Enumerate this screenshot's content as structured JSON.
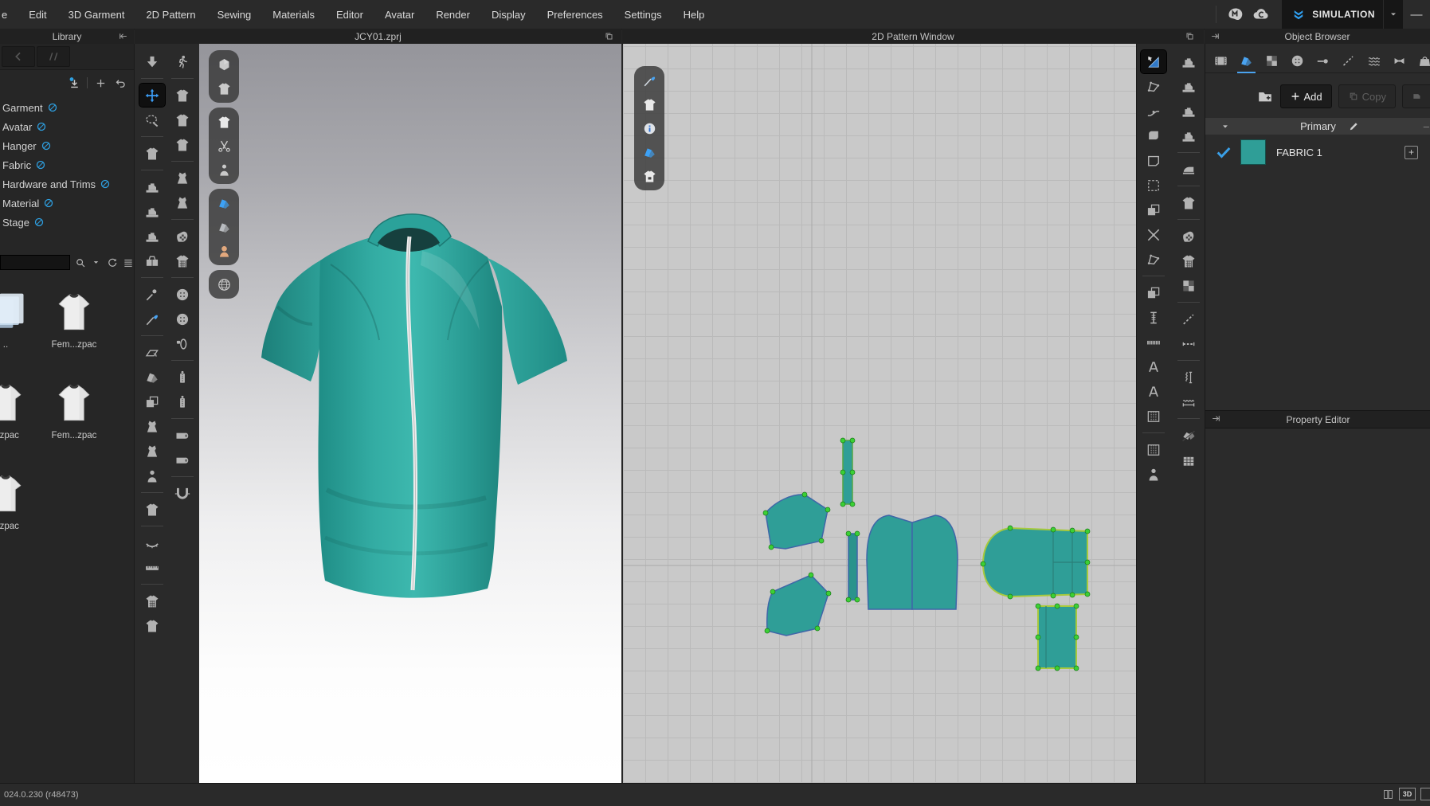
{
  "menu": {
    "items": [
      "e",
      "Edit",
      "3D Garment",
      "2D Pattern",
      "Sewing",
      "Materials",
      "Editor",
      "Avatar",
      "Render",
      "Display",
      "Preferences",
      "Settings",
      "Help"
    ]
  },
  "topbar": {
    "simulation": "SIMULATION"
  },
  "panels": {
    "library": "Library",
    "viewport3d": "JCY01.zprj",
    "pattern2d": "2D Pattern Window",
    "object_browser": "Object Browser",
    "property_editor": "Property Editor"
  },
  "library": {
    "categories": [
      "Garment",
      "Avatar",
      "Hanger",
      "Fabric",
      "Hardware and Trims",
      "Material",
      "Stage"
    ],
    "search_value": "",
    "thumbnails": [
      {
        "label": "..",
        "type": "folder"
      },
      {
        "label": "Fem...zpac",
        "type": "garment"
      },
      {
        "label": "...zpac",
        "type": "garment"
      },
      {
        "label": "Fem...zpac",
        "type": "garment"
      },
      {
        "label": "...zpac",
        "type": "garment"
      }
    ]
  },
  "toolbars": {
    "col_a": [
      "download-arrange",
      "sep",
      "move",
      "lasso-brush",
      "sep",
      "fit-garment",
      "sep",
      "sew-machine",
      "sew-machine-edit",
      "sew-machine-free",
      "sew-pieces",
      "sep",
      "pin-tack",
      "pen-3d",
      "sep",
      "fold-arrange",
      "folded-garment",
      "garment-pair",
      "wrap-drape",
      "wrap-rotate",
      "avatar-garment",
      "sep",
      "pattern-scale",
      "sep",
      "tape-curve",
      "tape-measure",
      "sep",
      "garment-measure",
      "garment-measure-b"
    ],
    "col_b": [
      "walk-avatar",
      "sep",
      "pin-garment",
      "pin-garment-b",
      "pin-garment-c",
      "sep",
      "pin-dress",
      "pin-dress-b",
      "sep",
      "glove-checker",
      "mesh-garment",
      "sep",
      "button-place",
      "button",
      "buttonhole",
      "sep",
      "zipper",
      "zipper-b",
      "sep",
      "fabric-roll",
      "fabric-roll-b",
      "sep",
      "magnet-pin"
    ],
    "float_3d": [
      [
        "view-cube",
        "garment-style"
      ],
      [
        "garment-show",
        "scissors-garment",
        "avatar-show"
      ],
      [
        "fabric-show",
        "fabric-texture",
        "avatar-skin"
      ],
      [
        "environment-globe"
      ]
    ],
    "float_2d": [
      [
        "needle-edit",
        "garment-2d",
        "pattern-info",
        "fabric-2d",
        "garment-lock"
      ]
    ],
    "col_c": [
      "transform-pattern",
      "edit-pattern",
      "edit-curvature",
      "pattern-shape",
      "pattern-outline",
      "marquee-select",
      "pattern-pair",
      "cross-tool",
      "trace-pattern",
      "sep",
      "clone-pattern",
      "notch-tool",
      "seam-tape",
      "text-pin",
      "text-tool",
      "pleats-tool",
      "sep",
      "strip-stack",
      "layer-mannequin"
    ],
    "col_d": [
      "sew-free",
      "sew-flat",
      "sew-curve",
      "sew-detect",
      "sep",
      "iron-press",
      "sep",
      "garment-fit-2d",
      "sep",
      "glove-2d",
      "mesh-2d",
      "checker-2d",
      "sep",
      "baste-pin",
      "baste",
      "sep",
      "shirring-pin",
      "shirring-tool",
      "sep",
      "pattern-cut",
      "gift-wrap"
    ]
  },
  "object_browser": {
    "tabs": [
      "scene-tab",
      "fabric-tab",
      "material-tab",
      "button-tab",
      "tack-tab",
      "topstitch-tab",
      "shirring-tab",
      "trim-tab",
      "accessory-tab"
    ],
    "active_tab": "fabric-tab",
    "add_label": "Add",
    "copy_label": "Copy",
    "section_label": "Primary",
    "fabric_name": "FABRIC 1",
    "fabric_color": "#2f9e97"
  },
  "pattern_pieces": [
    "collar-strip",
    "back-yoke",
    "front-yoke",
    "placket-strip",
    "front-panel-left",
    "front-panel-right",
    "sleeve",
    "cuff-rectangle"
  ],
  "status": {
    "version": "024.0.230 (r48473)",
    "view_badge": "3D"
  },
  "colors": {
    "accent_blue": "#4aa3f0",
    "garment_teal": "#2f9e97",
    "selection_green": "#3bd035",
    "pattern_outline_blue": "#3f66a8",
    "selected_outline_green": "#a7c93d",
    "grid_bg": "#c9c9c9"
  }
}
